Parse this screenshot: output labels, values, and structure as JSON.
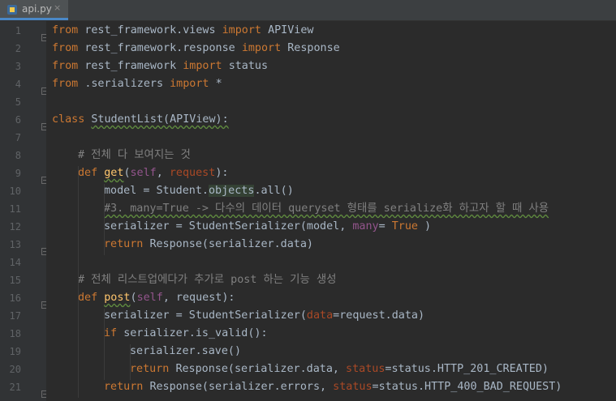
{
  "tab": {
    "label": "api.py",
    "close": "×",
    "icon": "python-file-icon"
  },
  "lines": [
    {
      "n": "1",
      "seg": [
        [
          "kw",
          "from"
        ],
        [
          "",
          "rest_framework.views"
        ],
        [
          "kw",
          "import"
        ],
        [
          "",
          "APIView"
        ]
      ]
    },
    {
      "n": "2",
      "seg": [
        [
          "kw",
          "from"
        ],
        [
          "",
          "rest_framework.response"
        ],
        [
          "kw",
          "import"
        ],
        [
          "",
          "Response"
        ]
      ]
    },
    {
      "n": "3",
      "seg": [
        [
          "kw",
          "from"
        ],
        [
          "",
          "rest_framework"
        ],
        [
          "kw",
          "import"
        ],
        [
          "",
          "status"
        ]
      ]
    },
    {
      "n": "4",
      "seg": [
        [
          "kw",
          "from"
        ],
        [
          "",
          ".serializers"
        ],
        [
          "kw",
          "import"
        ],
        [
          "",
          "*"
        ]
      ]
    },
    {
      "n": "5",
      "seg": []
    },
    {
      "n": "6",
      "seg": [
        [
          "kw",
          "class"
        ],
        [
          "",
          "StudentList(APIView):"
        ]
      ]
    },
    {
      "n": "7",
      "seg": []
    },
    {
      "n": "8",
      "seg": [
        [
          "cm",
          "# 전체 다 보여지는 것"
        ]
      ]
    },
    {
      "n": "9",
      "seg": [
        [
          "kw",
          "def"
        ],
        [
          "fn",
          "get"
        ],
        [
          "",
          "("
        ],
        [
          "slf",
          "self"
        ],
        [
          "",
          ", "
        ],
        [
          "prm",
          "request"
        ],
        [
          "",
          "):"
        ]
      ]
    },
    {
      "n": "10",
      "seg": [
        [
          "",
          "model = Student."
        ],
        [
          "",
          "objects"
        ],
        [
          "",
          ".all()"
        ]
      ]
    },
    {
      "n": "11",
      "seg": [
        [
          "cm",
          "#3. many=True -> 다수의 데이터 queryset 형태를 serialize화 하고자 할 때 사용"
        ]
      ]
    },
    {
      "n": "12",
      "seg": [
        [
          "",
          "serializer = StudentSerializer(model, "
        ],
        [
          "slf",
          "many"
        ],
        [
          "",
          "="
        ],
        [
          "kw",
          "True"
        ],
        [
          "",
          ")"
        ]
      ]
    },
    {
      "n": "13",
      "seg": [
        [
          "kw",
          "return"
        ],
        [
          "",
          "Response(serializer.data)"
        ]
      ]
    },
    {
      "n": "14",
      "seg": []
    },
    {
      "n": "15",
      "seg": [
        [
          "cm",
          "# 전체 리스트업에다가 추가로 post 하는 기능 생성"
        ]
      ]
    },
    {
      "n": "16",
      "seg": [
        [
          "kw",
          "def"
        ],
        [
          "fn",
          "post"
        ],
        [
          "",
          "("
        ],
        [
          "slf",
          "self"
        ],
        [
          "",
          ", request):"
        ]
      ]
    },
    {
      "n": "17",
      "seg": [
        [
          "",
          "serializer = StudentSerializer("
        ],
        [
          "prm",
          "data"
        ],
        [
          "",
          "=request.data)"
        ]
      ]
    },
    {
      "n": "18",
      "seg": [
        [
          "kw",
          "if"
        ],
        [
          "",
          "serializer.is_valid():"
        ]
      ]
    },
    {
      "n": "19",
      "seg": [
        [
          "",
          "serializer.save()"
        ]
      ]
    },
    {
      "n": "20",
      "seg": [
        [
          "kw",
          "return"
        ],
        [
          "",
          "Response(serializer.data, "
        ],
        [
          "prm",
          "status"
        ],
        [
          "",
          "=status.HTTP_201_CREATED)"
        ]
      ]
    },
    {
      "n": "21",
      "seg": [
        [
          "kw",
          "return"
        ],
        [
          "",
          "Response(serializer.errors, "
        ],
        [
          "prm",
          "status"
        ],
        [
          "",
          "=status.HTTP_400_BAD_REQUEST)"
        ]
      ]
    }
  ],
  "indent": [
    "0",
    "0",
    "0",
    "0",
    "0",
    "0",
    "0",
    "1",
    "1",
    "2",
    "2",
    "2",
    "2",
    "0",
    "1",
    "1",
    "2",
    "2",
    "3",
    "3",
    "2"
  ],
  "colors": {
    "keyword": "#cc7832",
    "comment": "#808080",
    "self": "#94558d",
    "param": "#aa4926",
    "default": "#a9b7c6",
    "function": "#ffc66d"
  }
}
